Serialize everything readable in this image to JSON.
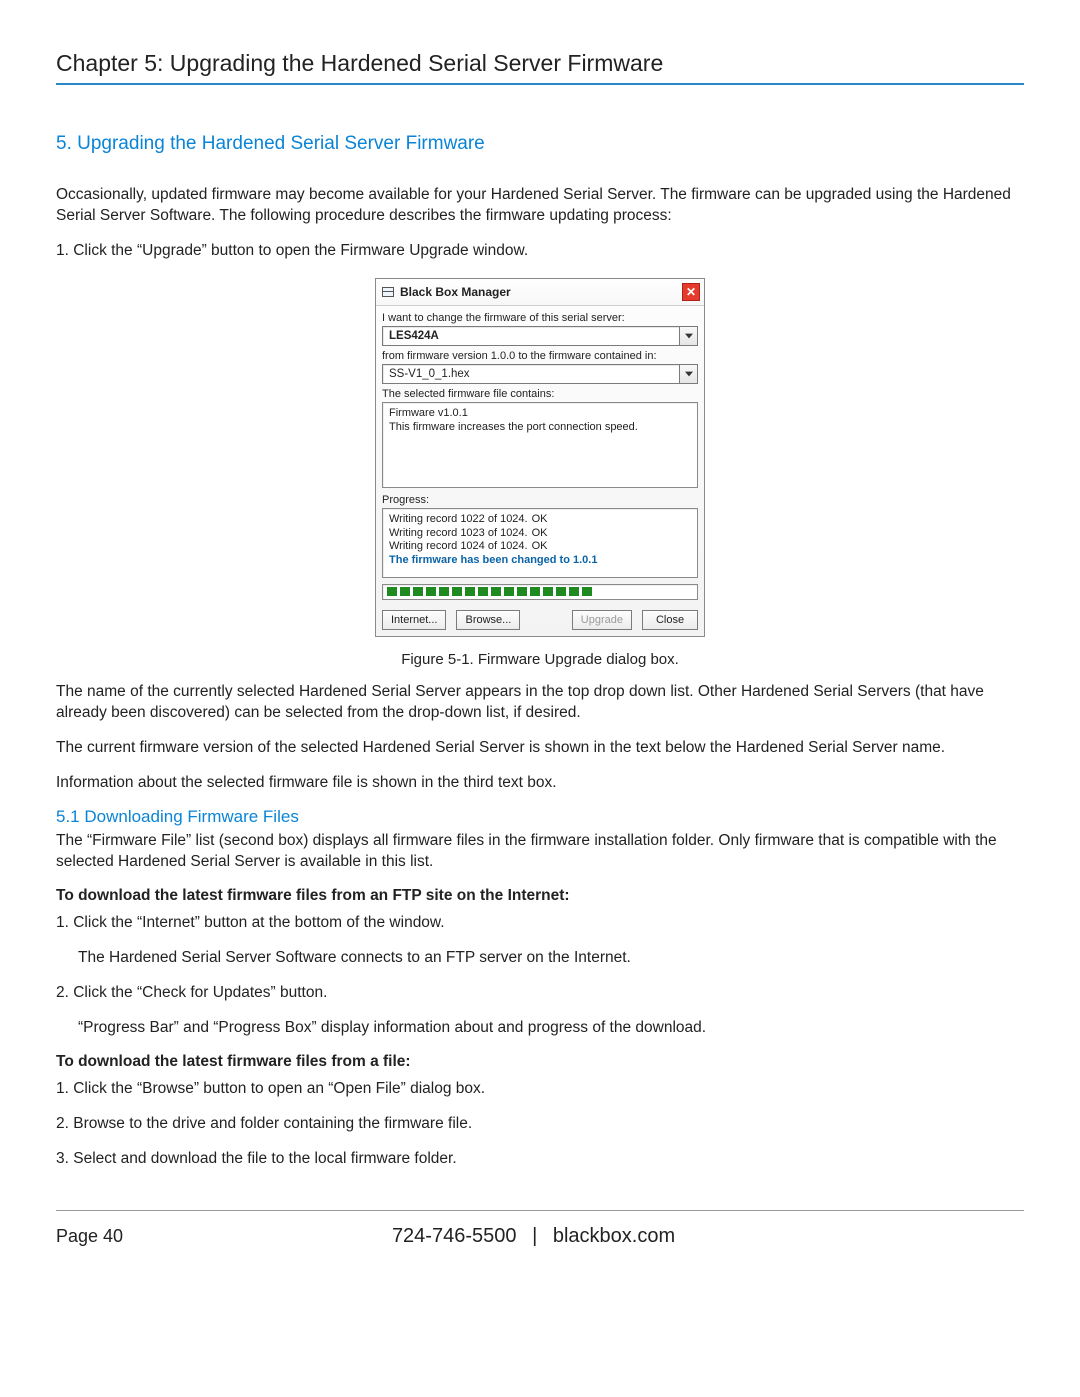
{
  "chapter_title": "Chapter 5: Upgrading the Hardened Serial Server Firmware",
  "section_heading": "5. Upgrading the Hardened Serial Server Firmware",
  "intro_para": "Occasionally, updated firmware may become available for your Hardened Serial Server. The firmware can be upgraded using the Hardened Serial Server Software. The following procedure describes the firmware updating process:",
  "step1": "1. Click the “Upgrade” button to open the Firmware Upgrade window.",
  "figure_caption": "Figure 5-1. Firmware Upgrade dialog box.",
  "after_fig_p1": "The name of the currently selected Hardened Serial Server appears in the top drop down list. Other Hardened Serial Servers (that have already been discovered) can be selected from the drop-down list, if desired.",
  "after_fig_p2": "The current firmware version of the selected Hardened Serial Server is shown in the text below the Hardened Serial Server name.",
  "after_fig_p3": "Information about the selected firmware file is shown in the third text box.",
  "sub_heading": "5.1 Downloading Firmware Files",
  "sub_p1": "The “Firmware File” list (second box) displays all firmware files in the firmware installation folder. Only firmware that is compatible with the selected Hardened Serial Server is available in this list.",
  "bold1": "To download the latest firmware files from an FTP site on the Internet:",
  "ftp_s1": "1. Click the “Internet” button at the bottom of the window.",
  "ftp_s1b": "The Hardened Serial Server Software connects to an FTP server on the Internet.",
  "ftp_s2": "2. Click the “Check for Updates” button.",
  "ftp_s2b": "“Progress Bar” and “Progress Box” display information about and progress of the download.",
  "bold2": "To download the latest firmware files from a file:",
  "file_s1": "1. Click the “Browse” button to open an “Open File” dialog box.",
  "file_s2": "2. Browse to the drive and folder containing the firmware file.",
  "file_s3": "3. Select and download the file to the local firmware folder.",
  "footer": {
    "page": "Page 40",
    "phone": "724-746-5500",
    "site": "blackbox.com",
    "sep": "|"
  },
  "dialog": {
    "title": "Black Box Manager",
    "label_change": "I want to change the firmware of this serial server:",
    "server_value": "LES424A",
    "label_from": "from firmware version 1.0.0 to the firmware contained in:",
    "file_value": "SS-V1_0_1.hex",
    "label_contains": "The selected firmware file contains:",
    "fw_line1": "Firmware v1.0.1",
    "fw_line2": "This firmware increases the port connection speed.",
    "label_progress": "Progress:",
    "p1a": "Writing record 1022 of 1024.",
    "p1b": "OK",
    "p2a": "Writing record 1023 of 1024.",
    "p2b": "OK",
    "p3a": "Writing record 1024 of 1024.",
    "p3b": "OK",
    "p4": "The firmware has been changed to 1.0.1",
    "btn_internet": "Internet...",
    "btn_browse": "Browse...",
    "btn_upgrade": "Upgrade",
    "btn_close": "Close"
  }
}
